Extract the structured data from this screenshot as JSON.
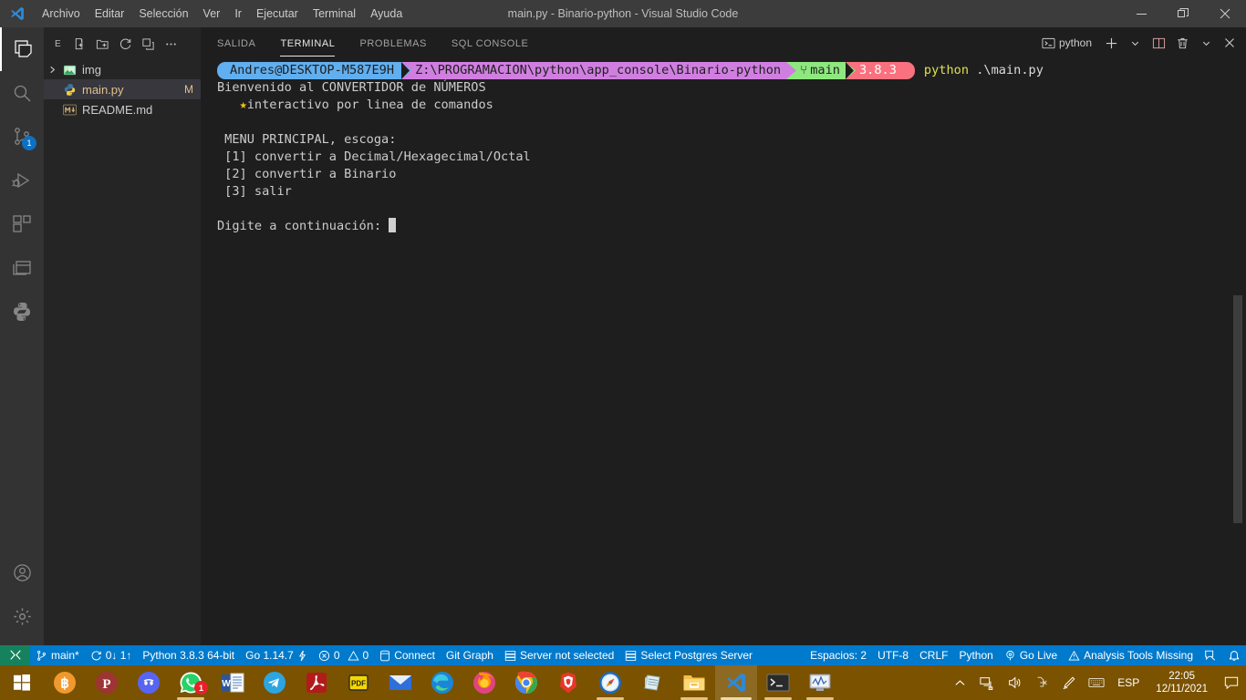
{
  "window": {
    "title": "main.py - Binario-python - Visual Studio Code",
    "logo": "vscode-logo",
    "menu": [
      "Archivo",
      "Editar",
      "Selección",
      "Ver",
      "Ir",
      "Ejecutar",
      "Terminal",
      "Ayuda"
    ],
    "controls": {
      "minimize": "minimize-icon",
      "restore": "restore-icon",
      "close": "close-icon"
    }
  },
  "activity_bar": {
    "items": [
      {
        "name": "explorer",
        "icon": "files-icon",
        "active": true,
        "badge": ""
      },
      {
        "name": "search",
        "icon": "search-icon",
        "active": false,
        "badge": ""
      },
      {
        "name": "source-control",
        "icon": "source-control-icon",
        "active": false,
        "badge": "1"
      },
      {
        "name": "run-and-debug",
        "icon": "run-debug-icon",
        "active": false,
        "badge": ""
      },
      {
        "name": "extensions",
        "icon": "extensions-icon",
        "active": false,
        "badge": ""
      },
      {
        "name": "remote-explorer",
        "icon": "remote-explorer-icon",
        "active": false,
        "badge": ""
      },
      {
        "name": "python",
        "icon": "python-icon",
        "active": false,
        "badge": ""
      }
    ],
    "bottom": [
      {
        "name": "accounts",
        "icon": "account-icon"
      },
      {
        "name": "settings",
        "icon": "gear-icon"
      }
    ]
  },
  "sidebar": {
    "title": "E",
    "actions": [
      "new-file-icon",
      "new-folder-icon",
      "refresh-icon",
      "collapse-all-icon",
      "more-actions-icon"
    ],
    "tree": [
      {
        "label": "img",
        "type": "folder",
        "icon": "folder-img-icon",
        "expanded": false,
        "badge": "",
        "selected": false,
        "chevron": "chevron-right-icon"
      },
      {
        "label": "main.py",
        "type": "file",
        "icon": "python-file-icon",
        "badge": "M",
        "selected": true,
        "modified": true
      },
      {
        "label": "README.md",
        "type": "file",
        "icon": "markdown-file-icon",
        "badge": "",
        "selected": false,
        "modified": false
      }
    ]
  },
  "panel": {
    "tabs": [
      {
        "label": "SALIDA",
        "active": false
      },
      {
        "label": "TERMINAL",
        "active": true
      },
      {
        "label": "PROBLEMAS",
        "active": false
      },
      {
        "label": "SQL CONSOLE",
        "active": false
      }
    ],
    "actions": {
      "terminal_selector_icon": "terminal-icon",
      "terminal_name": "python",
      "new_terminal_icon": "plus-icon",
      "new_terminal_dropdown_icon": "chevron-down-icon",
      "split_icon": "split-terminal-icon",
      "kill_icon": "trash-icon",
      "views_icon": "chevron-down-icon",
      "close_icon": "close-icon"
    }
  },
  "terminal": {
    "prompt": {
      "user": "Andres@DESKTOP-M587E9H",
      "path": "Z:\\PROGRAMACION\\python\\app_console\\Binario-python",
      "git_icon": "git-branch-icon",
      "git_branch": "main",
      "python_version": "3.8.3",
      "command_keyword": "python",
      "command_arg": ".\\main.py",
      "colors": {
        "user_bg": "#61afef",
        "path_bg": "#d07fe0",
        "git_bg": "#8ee87f",
        "python_bg": "#f9717f",
        "command_keyword": "#dfe04a"
      }
    },
    "output": [
      "Bienvenido al CONVERTIDOR de NÚMEROS",
      "  ★interactivo por linea de comandos",
      "",
      " MENU PRINCIPAL, escoga:",
      " [1] convertir a Decimal/Hexagecimal/Octal",
      " [2] convertir a Binario",
      " [3] salir",
      "",
      "Digite a continuación: "
    ],
    "output_lines": {
      "l1": "Bienvenido al CONVERTIDOR de NÚMEROS",
      "l2_star": "★",
      "l2_text": "interactivo por linea de comandos",
      "l4": " MENU PRINCIPAL, escoga:",
      "l5": " [1] convertir a Decimal/Hexagecimal/Octal",
      "l6": " [2] convertir a Binario",
      "l7": " [3] salir",
      "l9": "Digite a continuación: "
    }
  },
  "status_bar": {
    "remote_icon": "remote-window-icon",
    "left": [
      {
        "name": "git-branch",
        "icon": "git-branch-icon",
        "label": "main*"
      },
      {
        "name": "git-sync",
        "icon": "sync-icon",
        "label": "0↓ 1↑"
      },
      {
        "name": "python-interpreter",
        "icon": "",
        "label": "Python 3.8.3 64-bit"
      },
      {
        "name": "go-version",
        "icon": "go-bolt-icon",
        "label": "Go 1.14.7"
      },
      {
        "name": "problems",
        "icon": "error-warning-icon",
        "label": "0  0"
      },
      {
        "name": "sql-connect",
        "icon": "database-icon",
        "label": "Connect"
      },
      {
        "name": "git-graph",
        "icon": "",
        "label": "Git Graph"
      },
      {
        "name": "sql-server",
        "icon": "server-icon",
        "label": "Server not selected"
      },
      {
        "name": "postgres-server",
        "icon": "server-icon",
        "label": "Select Postgres Server"
      }
    ],
    "right": [
      {
        "name": "indentation",
        "icon": "",
        "label": "Espacios: 2"
      },
      {
        "name": "encoding",
        "icon": "",
        "label": "UTF-8"
      },
      {
        "name": "eol",
        "icon": "",
        "label": "CRLF"
      },
      {
        "name": "language-mode",
        "icon": "",
        "label": "Python"
      },
      {
        "name": "go-live",
        "icon": "broadcast-icon",
        "label": "Go Live"
      },
      {
        "name": "analysis-tools",
        "icon": "warning-icon",
        "label": "Analysis Tools Missing"
      },
      {
        "name": "feedback",
        "icon": "feedback-icon",
        "label": ""
      },
      {
        "name": "notifications",
        "icon": "bell-icon",
        "label": ""
      }
    ],
    "problems_errors": "0",
    "problems_warnings": "0"
  },
  "taskbar": {
    "start": "windows-start-icon",
    "apps": [
      {
        "name": "bitcoin",
        "icon": "bitcoin-icon",
        "state": "pinned"
      },
      {
        "name": "pushbullet",
        "icon": "pushbullet-icon",
        "state": "pinned"
      },
      {
        "name": "discord",
        "icon": "discord-icon",
        "state": "pinned"
      },
      {
        "name": "whatsapp",
        "icon": "whatsapp-icon",
        "state": "running",
        "badge": "1"
      },
      {
        "name": "word",
        "icon": "word-icon",
        "state": "pinned"
      },
      {
        "name": "telegram",
        "icon": "telegram-icon",
        "state": "pinned"
      },
      {
        "name": "acrobat",
        "icon": "acrobat-icon",
        "state": "pinned"
      },
      {
        "name": "pdf-editor",
        "icon": "pdf-icon",
        "state": "pinned"
      },
      {
        "name": "mail",
        "icon": "mail-icon",
        "state": "pinned"
      },
      {
        "name": "edge",
        "icon": "edge-icon",
        "state": "pinned"
      },
      {
        "name": "firefox",
        "icon": "firefox-icon",
        "state": "pinned"
      },
      {
        "name": "chrome",
        "icon": "chrome-icon",
        "state": "pinned"
      },
      {
        "name": "brave",
        "icon": "brave-icon",
        "state": "pinned"
      },
      {
        "name": "safari",
        "icon": "compass-icon",
        "state": "running"
      },
      {
        "name": "notepad",
        "icon": "notepad-icon",
        "state": "pinned"
      },
      {
        "name": "file-explorer",
        "icon": "folder-icon",
        "state": "running"
      },
      {
        "name": "vscode",
        "icon": "vscode-icon",
        "state": "active"
      },
      {
        "name": "terminal",
        "icon": "console-icon",
        "state": "running"
      },
      {
        "name": "task-manager",
        "icon": "task-manager-icon",
        "state": "running"
      }
    ],
    "tray": {
      "show_hidden": "chevron-up-icon",
      "network": "network-icon",
      "volume": "volume-icon",
      "bluetooth": "bluetooth-icon",
      "pen": "pen-icon",
      "keyboard": "keyboard-icon",
      "language": "ESP",
      "time": "22:05",
      "date": "12/11/2021",
      "action_center": "action-center-icon"
    }
  }
}
